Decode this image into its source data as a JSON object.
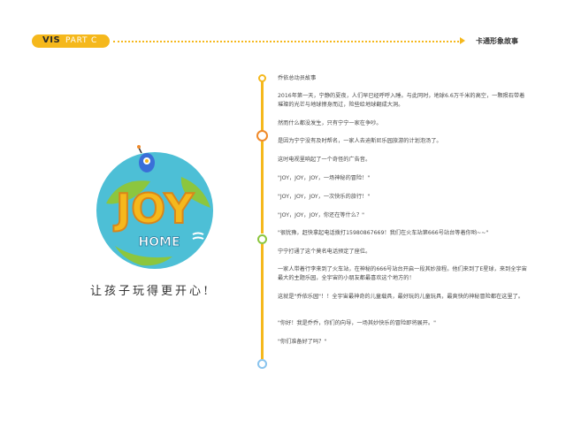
{
  "header": {
    "badge_vis": "VIS",
    "badge_part": "PART C",
    "title": "卡通形象故事"
  },
  "logo": {
    "word_top": "JOY",
    "word_bottom": "HOME",
    "colors": {
      "circle": "#4dbfd6",
      "land": "#8cc63e",
      "letters": "#f5b81c",
      "home": "#ffffff",
      "robot": "#3a6fd8"
    }
  },
  "slogan": "让孩子玩得更开心!",
  "story": {
    "heading": "乔依总动员故事",
    "paragraphs": [
      "2016年第一天，宁静的夏夜，人们早已经呼呼入睡。与此同时，地球6.6万千米的高空，一颗陨石带着璀璨的光芒与地球擦身而过，险些给地球翻成大洞。",
      "然而什么都没发生，只有宁宁一家在争吵。",
      "是因为宁宁没有及时帮名，一家人去迪斯尼乐园旅游的计划泡汤了。",
      "这时电视里响起了一个奇怪的广告音。",
      "\"JOY，JOY，JOY，一场神秘的冒险！\"",
      "\"JOY，JOY，JOY，一次快乐的旅行！\"",
      "\"JOY，JOY，JOY，你还在等什么？\"",
      "\"很犹豫，赶快拿起电话拨打15980867669！我们在火车站第666号站台等着你哟~~\"",
      "宁宁打通了这个莫名电话预定了座位。",
      "一家人带着行李来到了火车站，在神秘的666号站台开启一段其妙旅程。他们来到了E星球，来到全宇宙最大的主题乐园，全宇宙的小朋友都最喜欢这个地方的！",
      "这就是\"乔依乐园\"！！全宇宙最神奇的儿童载具，最好玩的儿童玩具，最爽快的神秘冒险都在这里了。",
      "\"你好！我是乔乔，你们的向导，一场其妙快乐的冒险即将展开。\"",
      "\"你们准备好了吗？\""
    ]
  }
}
